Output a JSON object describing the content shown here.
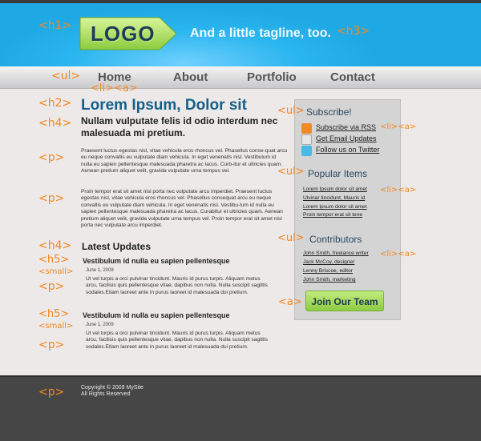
{
  "header": {
    "logo_text": "LOGO",
    "tagline": "And a little tagline, too.",
    "tag_h1": "<h1>",
    "tag_h3": "<h3>"
  },
  "nav": {
    "tag_ul": "<ul>",
    "tag_li_a": "<li><a>",
    "items": [
      "Home",
      "About",
      "Portfolio",
      "Contact"
    ]
  },
  "main": {
    "tag_h2": "<h2>",
    "tag_h4": "<h4>",
    "tag_p": "<p>",
    "heading": "Lorem Ipsum, Dolor sit",
    "subheading": "Nullam vulputate felis id odio interdum nec malesuada mi pretium.",
    "paragraph1": "Praesent luctus egestas nisl, vitae vehicula eros rhoncus vel. Phasellus conse-quat arcu eu neque convallis eu vulputate diam vehicula. In eget venenatis nisl. Vestibulum id nulla eu sapien pellentesque malesuada pharetra ac lacus. Curb-itur et ultricies quam. Aenean pretium aliquet velit, gravida vulputate urna tempus vel.",
    "paragraph2": "Proin tempor erat sit amet nisl porta nec vulputate arcu imperdiet. Praesent luctus egestas nisl, vitae vehicula eros rhoncus vel. Phasellus consequat arcu eu neque convallis eu vulputate diam vehicula. In eget venenatis nisl. Vestibu-lum id nulla eu sapien pellentesque malesuada pharetra ac lacus. Curabitur et ultricies quam. Aenean pretium aliquet velit, gravida vulputate urna tempus vel. Proin tempor erat sit amet nisl porta nec vulputate arcu imperdiet."
  },
  "updates": {
    "tag_h4": "<h4>",
    "tag_h5": "<h5>",
    "tag_small": "<small>",
    "tag_p": "<p>",
    "title": "Latest Updates",
    "items": [
      {
        "title": "Vestibulum id nulla eu sapien pellentesque",
        "date": "June 1, 2009",
        "body": "Ut vel turpis a orci pulvinar tincidunt. Mauris id purus turpis. Aliquam metus arcu, facilisis quis pellentesque vitae, dapibus non nulla. Nulla suscipit sagittis sodales.Etiam laoreet ante in purus laoreet id malesuada dui pretium."
      },
      {
        "title": "Vestibulum id nulla eu sapien pellentesque",
        "date": "June 1, 2009",
        "body": "Ut vel turpis a orci pulvinar tincidunt. Mauris id purus turpis. Aliquam metus arcu, facilisis quis pellentesque vitae, dapibus non nulla. Nulla suscipit sagittis sodales.Etiam laoreet ante in purus laoreet id malesuada dui pretium."
      }
    ]
  },
  "sidebar": {
    "tag_ul": "<ul>",
    "tag_li_a": "<li><a>",
    "tag_a": "<a>",
    "subscribe_title": "Subscribe!",
    "subscribe_items": [
      {
        "label": "Subscribe via RSS",
        "icon": "rss-icon",
        "color": "#f08a24"
      },
      {
        "label": "Get Email Updates",
        "icon": "email-icon",
        "color": "#e6e6e6"
      },
      {
        "label": "Follow us on Twitter",
        "icon": "twitter-icon",
        "color": "#49b9e6"
      }
    ],
    "popular_title": "Popular Items",
    "popular_items": [
      "Lorem Ipsum dolor sit amet",
      "Ulvinar tincidunt, Mauris id",
      "Lorem ipsum dolor sit amet",
      "Proin tempor erat sit tene"
    ],
    "contributors_title": "Contributors",
    "contributors": [
      "John Smith, freelance writer",
      "Jack McCoy, designer",
      "Lenny Briscoe, editor",
      "John Smith, marketing"
    ],
    "join_button": "Join Our Team"
  },
  "footer": {
    "tag_p": "<p>",
    "copyright": "Copyright © 2009 MySite",
    "rights": "All Rights Reserved"
  }
}
